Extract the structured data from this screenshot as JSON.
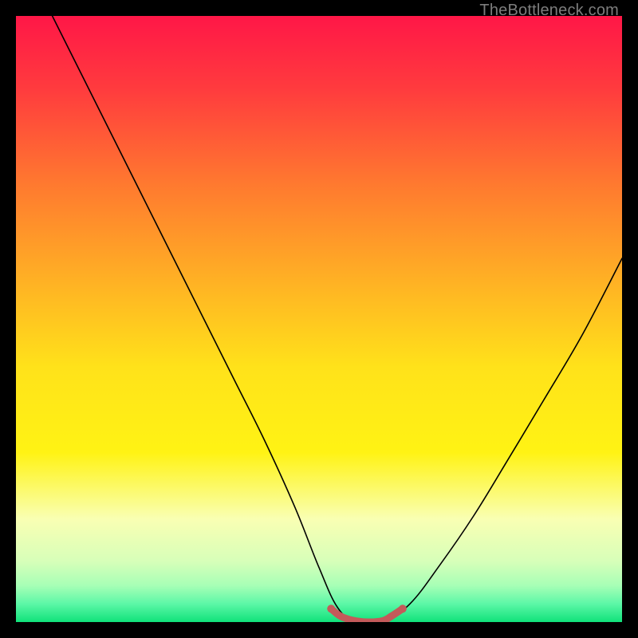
{
  "watermark": "TheBottleneck.com",
  "chart_data": {
    "type": "line",
    "title": "",
    "xlabel": "",
    "ylabel": "",
    "xlim": [
      0,
      1
    ],
    "ylim": [
      0,
      1
    ],
    "grid": false,
    "legend": false,
    "background_gradient_stops": [
      {
        "offset": 0.0,
        "color": "#ff1747"
      },
      {
        "offset": 0.12,
        "color": "#ff3b3e"
      },
      {
        "offset": 0.28,
        "color": "#ff7a2f"
      },
      {
        "offset": 0.44,
        "color": "#ffb224"
      },
      {
        "offset": 0.58,
        "color": "#ffe21a"
      },
      {
        "offset": 0.72,
        "color": "#fff314"
      },
      {
        "offset": 0.83,
        "color": "#f9ffb3"
      },
      {
        "offset": 0.9,
        "color": "#d7ffb9"
      },
      {
        "offset": 0.94,
        "color": "#a7ffb6"
      },
      {
        "offset": 0.97,
        "color": "#5cf7a7"
      },
      {
        "offset": 1.0,
        "color": "#10e27a"
      }
    ],
    "series": [
      {
        "name": "bottleneck-curve",
        "color": "#000000",
        "stroke_width": 1.6,
        "x": [
          0.06,
          0.11,
          0.16,
          0.21,
          0.26,
          0.31,
          0.36,
          0.41,
          0.46,
          0.5,
          0.53,
          0.56,
          0.605,
          0.65,
          0.7,
          0.755,
          0.81,
          0.87,
          0.935,
          1.0
        ],
        "y": [
          1.0,
          0.9,
          0.8,
          0.7,
          0.6,
          0.5,
          0.4,
          0.3,
          0.19,
          0.09,
          0.025,
          0.0,
          0.0,
          0.03,
          0.095,
          0.175,
          0.265,
          0.365,
          0.475,
          0.6
        ]
      },
      {
        "name": "highlight-segment",
        "color": "#c45a5a",
        "stroke_width": 9,
        "x": [
          0.52,
          0.535,
          0.555,
          0.58,
          0.605,
          0.62,
          0.638
        ],
        "y": [
          0.022,
          0.01,
          0.003,
          0.0,
          0.002,
          0.01,
          0.022
        ],
        "endpoint_radius": 5
      }
    ]
  }
}
